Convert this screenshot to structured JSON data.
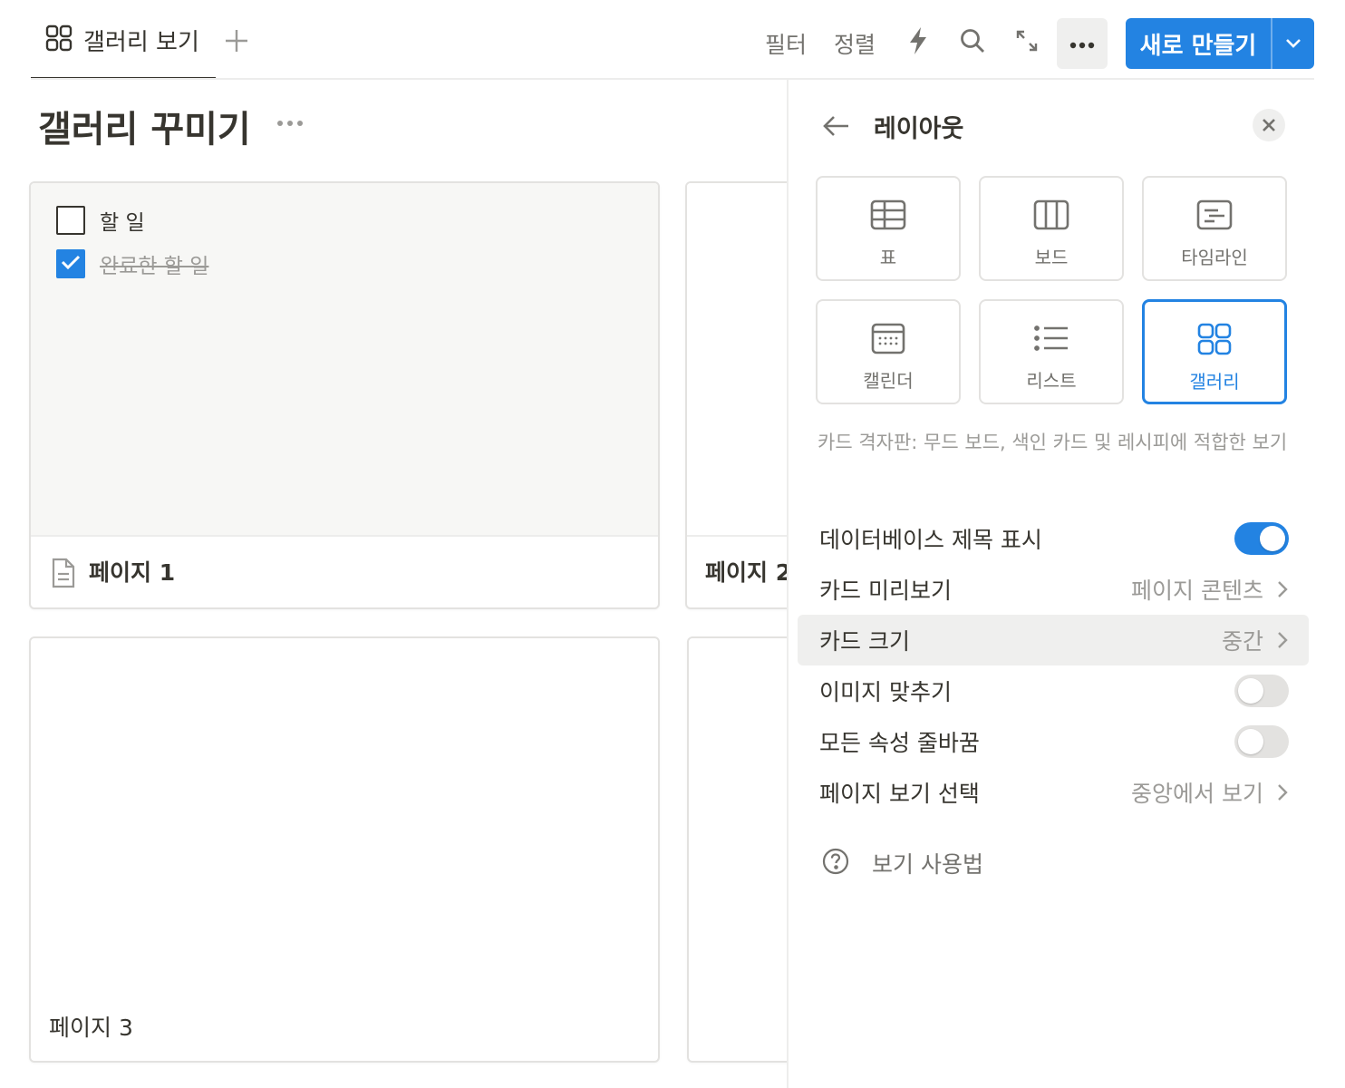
{
  "view_tab": {
    "icon": "gallery-grid-icon",
    "label": "갤러리 보기"
  },
  "toolbar": {
    "add_view_icon": "plus-icon",
    "filter_label": "필터",
    "sort_label": "정렬",
    "automation_icon": "lightning-icon",
    "search_icon": "search-icon",
    "expand_icon": "expand-arrows-icon",
    "more_icon": "more-dots-icon",
    "new_label": "새로 만들기",
    "new_caret_icon": "chevron-down-icon",
    "accent_color": "#2383e2"
  },
  "page": {
    "title": "갤러리 꾸미기",
    "more_icon": "more-dots-icon"
  },
  "cards": [
    {
      "title": "페이지 1",
      "page_icon": "document-icon",
      "todos": [
        {
          "text": "할 일",
          "checked": false
        },
        {
          "text": "완료한 할 일",
          "checked": true
        }
      ]
    },
    {
      "title": "페이지 2"
    },
    {
      "title": "페이지 3"
    },
    {
      "title": ""
    }
  ],
  "panel": {
    "back_icon": "arrow-left-icon",
    "title": "레이아웃",
    "close_icon": "close-icon",
    "layouts": [
      {
        "label": "표",
        "icon": "table-icon",
        "selected": false
      },
      {
        "label": "보드",
        "icon": "board-icon",
        "selected": false
      },
      {
        "label": "타임라인",
        "icon": "timeline-icon",
        "selected": false
      },
      {
        "label": "캘린더",
        "icon": "calendar-icon",
        "selected": false
      },
      {
        "label": "리스트",
        "icon": "list-icon",
        "selected": false
      },
      {
        "label": "갤러리",
        "icon": "gallery-grid-icon",
        "selected": true
      }
    ],
    "description": "카드 격자판: 무드 보드, 색인 카드 및 레시피에 적합한 보기",
    "settings": [
      {
        "label": "데이터베이스 제목 표시",
        "type": "toggle",
        "on": true
      },
      {
        "label": "카드 미리보기",
        "type": "select",
        "value": "페이지 콘텐츠"
      },
      {
        "label": "카드 크기",
        "type": "select",
        "value": "중간"
      },
      {
        "label": "이미지 맞추기",
        "type": "toggle",
        "on": false
      },
      {
        "label": "모든 속성 줄바꿈",
        "type": "toggle",
        "on": false
      },
      {
        "label": "페이지 보기 선택",
        "type": "select",
        "value": "중앙에서 보기"
      }
    ],
    "help": {
      "icon": "question-circle-icon",
      "label": "보기 사용법"
    }
  }
}
